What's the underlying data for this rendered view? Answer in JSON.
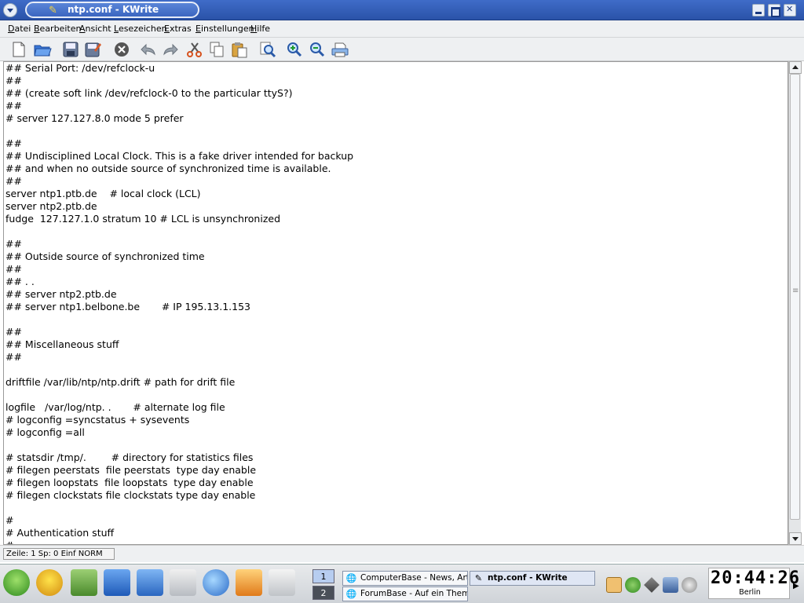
{
  "window": {
    "title": "ntp.conf - KWrite"
  },
  "menubar": {
    "items": [
      "Datei",
      "Bearbeiten",
      "Ansicht",
      "Lesezeichen",
      "Extras",
      "Einstellungen",
      "Hilfe"
    ]
  },
  "toolbar": {
    "buttons": [
      "new-icon",
      "open-icon",
      "save-icon",
      "save-as-icon",
      "close-doc-icon",
      "undo-icon",
      "redo-icon",
      "cut-icon",
      "copy-icon",
      "paste-icon",
      "find-icon",
      "zoom-in-icon",
      "zoom-out-icon",
      "print-icon"
    ]
  },
  "editor": {
    "lines": [
      "## Serial Port: /dev/refclock-u",
      "##",
      "## (create soft link /dev/refclock-0 to the particular ttyS?)",
      "##",
      "# server 127.127.8.0 mode 5 prefer",
      "",
      "##",
      "## Undisciplined Local Clock. This is a fake driver intended for backup",
      "## and when no outside source of synchronized time is available.",
      "##",
      "server ntp1.ptb.de    # local clock (LCL)",
      "server ntp2.ptb.de",
      "fudge  127.127.1.0 stratum 10 # LCL is unsynchronized",
      "",
      "##",
      "## Outside source of synchronized time",
      "##",
      "## . .",
      "## server ntp2.ptb.de",
      "## server ntp1.belbone.be       # IP 195.13.1.153",
      "",
      "##",
      "## Miscellaneous stuff",
      "##",
      "",
      "driftfile /var/lib/ntp/ntp.drift # path for drift file",
      "",
      "logfile   /var/log/ntp. .       # alternate log file",
      "# logconfig =syncstatus + sysevents",
      "# logconfig =all",
      "",
      "# statsdir /tmp/.        # directory for statistics files",
      "# filegen peerstats  file peerstats  type day enable",
      "# filegen loopstats  file loopstats  type day enable",
      "# filegen clockstats file clockstats type day enable",
      "",
      "#",
      "# Authentication stuff",
      "#"
    ]
  },
  "statusbar": {
    "text": "Zeile: 1 Sp: 0  Einf  NORM"
  },
  "taskbar": {
    "pager": [
      "1",
      "2"
    ],
    "tasks": [
      {
        "label": "ComputerBase - News, Artik",
        "icon": "konqueror-icon"
      },
      {
        "label": "ForumBase - Auf ein Thema a",
        "icon": "konqueror-icon"
      },
      {
        "label": "ntp.conf - KWrite",
        "icon": "kwrite-icon"
      }
    ],
    "clock": {
      "time": "20:44:26",
      "city": "Berlin"
    }
  },
  "colors": {
    "titlebar": "#2f5bb4",
    "chrome": "#eef0f2",
    "editor_bg": "#ffffff"
  }
}
